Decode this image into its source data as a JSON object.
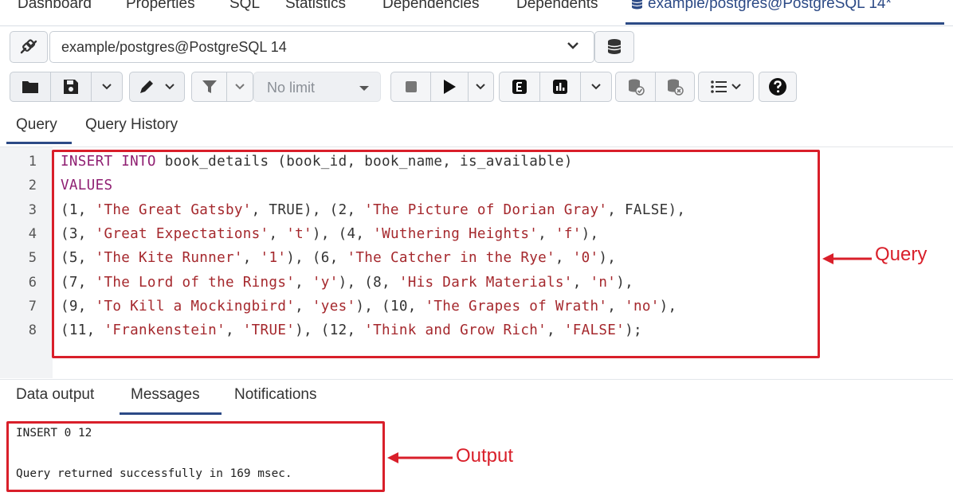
{
  "top_tabs": {
    "items": [
      "Dashboard",
      "Properties",
      "SQL",
      "Statistics",
      "Dependencies",
      "Dependents"
    ],
    "active": "example/postgres@PostgreSQL 14*"
  },
  "connection": {
    "value": "example/postgres@PostgreSQL 14"
  },
  "toolbar": {
    "limit_label": "No limit"
  },
  "query_tabs": [
    "Query",
    "Query History"
  ],
  "editor": {
    "line_numbers": [
      "1",
      "2",
      "3",
      "4",
      "5",
      "6",
      "7",
      "8"
    ],
    "lines": [
      [
        {
          "t": "INSERT INTO",
          "k": "kw"
        },
        {
          "t": " book_details (book_id, book_name, is_available)",
          "k": "p"
        }
      ],
      [
        {
          "t": "VALUES",
          "k": "kw"
        }
      ],
      [
        {
          "t": "(1, ",
          "k": "p"
        },
        {
          "t": "'The Great Gatsby'",
          "k": "str"
        },
        {
          "t": ", TRUE), (2, ",
          "k": "p"
        },
        {
          "t": "'The Picture of Dorian Gray'",
          "k": "str"
        },
        {
          "t": ", FALSE),",
          "k": "p"
        }
      ],
      [
        {
          "t": "(3, ",
          "k": "p"
        },
        {
          "t": "'Great Expectations'",
          "k": "str"
        },
        {
          "t": ", ",
          "k": "p"
        },
        {
          "t": "'t'",
          "k": "str"
        },
        {
          "t": "), (4, ",
          "k": "p"
        },
        {
          "t": "'Wuthering Heights'",
          "k": "str"
        },
        {
          "t": ", ",
          "k": "p"
        },
        {
          "t": "'f'",
          "k": "str"
        },
        {
          "t": "),",
          "k": "p"
        }
      ],
      [
        {
          "t": "(5, ",
          "k": "p"
        },
        {
          "t": "'The Kite Runner'",
          "k": "str"
        },
        {
          "t": ", ",
          "k": "p"
        },
        {
          "t": "'1'",
          "k": "str"
        },
        {
          "t": "), (6, ",
          "k": "p"
        },
        {
          "t": "'The Catcher in the Rye'",
          "k": "str"
        },
        {
          "t": ", ",
          "k": "p"
        },
        {
          "t": "'0'",
          "k": "str"
        },
        {
          "t": "),",
          "k": "p"
        }
      ],
      [
        {
          "t": "(7, ",
          "k": "p"
        },
        {
          "t": "'The Lord of the Rings'",
          "k": "str"
        },
        {
          "t": ", ",
          "k": "p"
        },
        {
          "t": "'y'",
          "k": "str"
        },
        {
          "t": "), (8, ",
          "k": "p"
        },
        {
          "t": "'His Dark Materials'",
          "k": "str"
        },
        {
          "t": ", ",
          "k": "p"
        },
        {
          "t": "'n'",
          "k": "str"
        },
        {
          "t": "),",
          "k": "p"
        }
      ],
      [
        {
          "t": "(9, ",
          "k": "p"
        },
        {
          "t": "'To Kill a Mockingbird'",
          "k": "str"
        },
        {
          "t": ", ",
          "k": "p"
        },
        {
          "t": "'yes'",
          "k": "str"
        },
        {
          "t": "), (10, ",
          "k": "p"
        },
        {
          "t": "'The Grapes of Wrath'",
          "k": "str"
        },
        {
          "t": ", ",
          "k": "p"
        },
        {
          "t": "'no'",
          "k": "str"
        },
        {
          "t": "),",
          "k": "p"
        }
      ],
      [
        {
          "t": "(11, ",
          "k": "p"
        },
        {
          "t": "'Frankenstein'",
          "k": "str"
        },
        {
          "t": ", ",
          "k": "p"
        },
        {
          "t": "'TRUE'",
          "k": "str"
        },
        {
          "t": "), (12, ",
          "k": "p"
        },
        {
          "t": "'Think and Grow Rich'",
          "k": "str"
        },
        {
          "t": ", ",
          "k": "p"
        },
        {
          "t": "'FALSE'",
          "k": "str"
        },
        {
          "t": ");",
          "k": "p"
        }
      ]
    ]
  },
  "output_tabs": [
    "Data output",
    "Messages",
    "Notifications"
  ],
  "output": {
    "line1": "INSERT 0 12",
    "line2": "Query returned successfully in 169 msec."
  },
  "annotations": {
    "query": "Query",
    "output": "Output"
  },
  "colors": {
    "accent": "#2c4a86",
    "annotation": "#d91f2a",
    "keyword": "#8f1f72",
    "string": "#a5282d"
  },
  "icons": [
    "sqlite-icon",
    "database-icon",
    "folder-icon",
    "save-icon",
    "pencil-icon",
    "filter-icon",
    "stop-icon",
    "play-icon",
    "explain-icon",
    "explain-analyze-icon",
    "commit-icon",
    "rollback-icon",
    "macros-icon",
    "help-icon",
    "chevron-down-icon"
  ]
}
